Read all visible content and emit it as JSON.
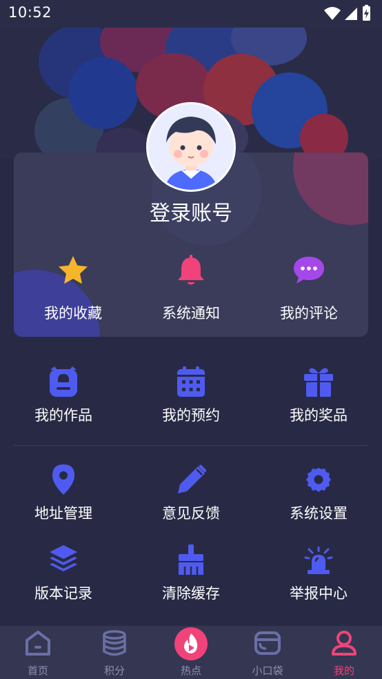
{
  "status": {
    "time": "10:52"
  },
  "profile": {
    "login_label": "登录账号"
  },
  "quick_actions": [
    {
      "label": "我的收藏",
      "icon": "star-icon",
      "color": "#f7b52b"
    },
    {
      "label": "系统通知",
      "icon": "bell-icon",
      "color": "#f0437a"
    },
    {
      "label": "我的评论",
      "icon": "chat-icon",
      "color": "#a548ea"
    }
  ],
  "menu_row1": [
    {
      "label": "我的作品",
      "icon": "backpack-icon"
    },
    {
      "label": "我的预约",
      "icon": "calendar-icon"
    },
    {
      "label": "我的奖品",
      "icon": "gift-icon"
    }
  ],
  "menu_row2": [
    {
      "label": "地址管理",
      "icon": "location-pin-icon"
    },
    {
      "label": "意见反馈",
      "icon": "pencil-icon"
    },
    {
      "label": "系统设置",
      "icon": "gear-icon"
    }
  ],
  "menu_row3": [
    {
      "label": "版本记录",
      "icon": "layers-icon"
    },
    {
      "label": "清除缓存",
      "icon": "broom-icon"
    },
    {
      "label": "举报中心",
      "icon": "alarm-siren-icon"
    }
  ],
  "bottom_nav": [
    {
      "label": "首页",
      "icon": "home-icon"
    },
    {
      "label": "积分",
      "icon": "database-icon"
    },
    {
      "label": "热点",
      "icon": "flame-play-icon"
    },
    {
      "label": "小口袋",
      "icon": "wallet-icon"
    },
    {
      "label": "我的",
      "icon": "user-icon",
      "active": true
    }
  ],
  "colors": {
    "background": "#282a45",
    "card": "#3a3c5a",
    "menu_icon": "#4f5bf0",
    "accent": "#f0437a",
    "nav_inactive": "#6a6fa6"
  }
}
